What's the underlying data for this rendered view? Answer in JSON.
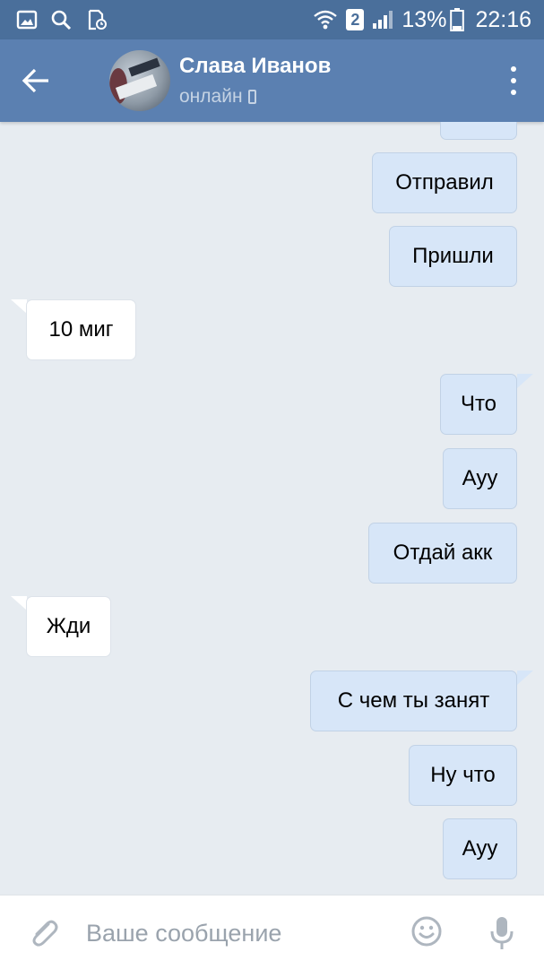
{
  "status_bar": {
    "battery_percent": "13%",
    "time": "22:16",
    "sim_slot": "2",
    "icons": [
      "gallery-icon",
      "search-icon",
      "file-clock-icon",
      "wifi-icon",
      "sim-2-icon",
      "signal-icon",
      "battery-icon"
    ]
  },
  "header": {
    "contact_name": "Слава Иванов",
    "contact_status": "онлайн",
    "icons": [
      "back-arrow-icon",
      "avatar",
      "phone-icon",
      "more-vertical-icon"
    ]
  },
  "messages": [
    {
      "direction": "out",
      "text": ""
    },
    {
      "direction": "out",
      "text": "Отправил"
    },
    {
      "direction": "out",
      "text": "Пришли"
    },
    {
      "direction": "in",
      "text": "10 миг"
    },
    {
      "direction": "out",
      "text": "Что"
    },
    {
      "direction": "out",
      "text": "Ауу"
    },
    {
      "direction": "out",
      "text": "Отдай акк"
    },
    {
      "direction": "in",
      "text": "Жди"
    },
    {
      "direction": "out",
      "text": "С чем ты занят"
    },
    {
      "direction": "out",
      "text": "Ну что"
    },
    {
      "direction": "out",
      "text": "Ауу"
    }
  ],
  "input_bar": {
    "placeholder": "Ваше сообщение",
    "value": "",
    "icons": [
      "paperclip-icon",
      "emoji-icon",
      "microphone-icon"
    ]
  },
  "colors": {
    "status_bar": "#4a6f9b",
    "header": "#5b80b1",
    "background": "#e7ecf1",
    "outgoing_bubble": "#d7e6f8",
    "incoming_bubble": "#ffffff"
  }
}
